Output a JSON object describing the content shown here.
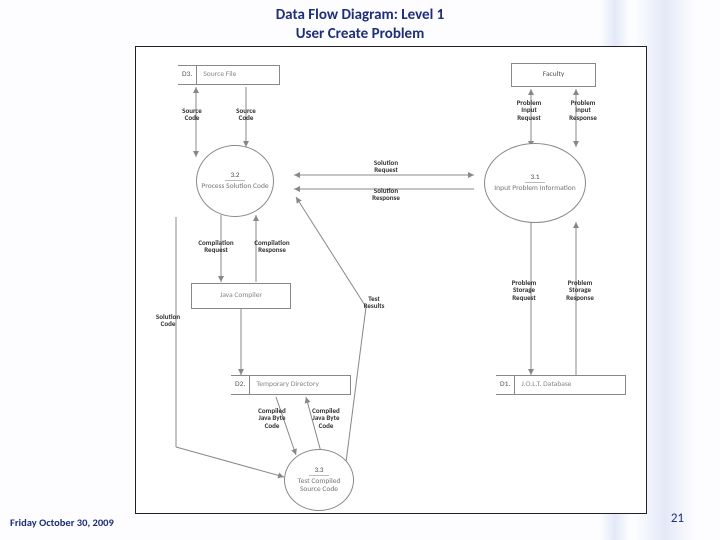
{
  "title": {
    "line1": "Data Flow Diagram: Level 1",
    "line2": "User Create Problem"
  },
  "footer": {
    "date": "Friday October 30, 2009",
    "page": "21"
  },
  "datastores": {
    "d3": {
      "id": "D3.",
      "label": "Source File"
    },
    "d2": {
      "id": "D2.",
      "label": "Temporary Directory"
    },
    "d1": {
      "id": "D1.",
      "label": "J.O.L.T. Database"
    }
  },
  "entities": {
    "faculty": "Faculty",
    "compiler": "Java Compiler"
  },
  "processes": {
    "p31": {
      "id": "3.1",
      "label": "Input Problem Information"
    },
    "p32": {
      "id": "3.2",
      "label": "Process Solution Code"
    },
    "p33": {
      "id": "3.3",
      "label": "Test Compiled Source Code"
    }
  },
  "flows": {
    "source_code_a": "Source\nCode",
    "source_code_b": "Source\nCode",
    "solution_request": "Solution\nRequest",
    "solution_response": "Solution\nResponse",
    "problem_input_request": "Problem\nInput\nRequest",
    "problem_input_response": "Problem\nInput\nResponse",
    "compilation_request": "Compilation\nRequest",
    "compilation_response": "Compilation\nResponse",
    "solution_code": "Solution\nCode",
    "test_results": "Test\nResults",
    "compiled_jbc_a": "Compiled\nJava Byte\nCode",
    "compiled_jbc_b": "Compiled\nJava Byte\nCode",
    "problem_storage_request": "Problem\nStorage\nRequest",
    "problem_storage_response": "Problem\nStorage\nResponse"
  }
}
